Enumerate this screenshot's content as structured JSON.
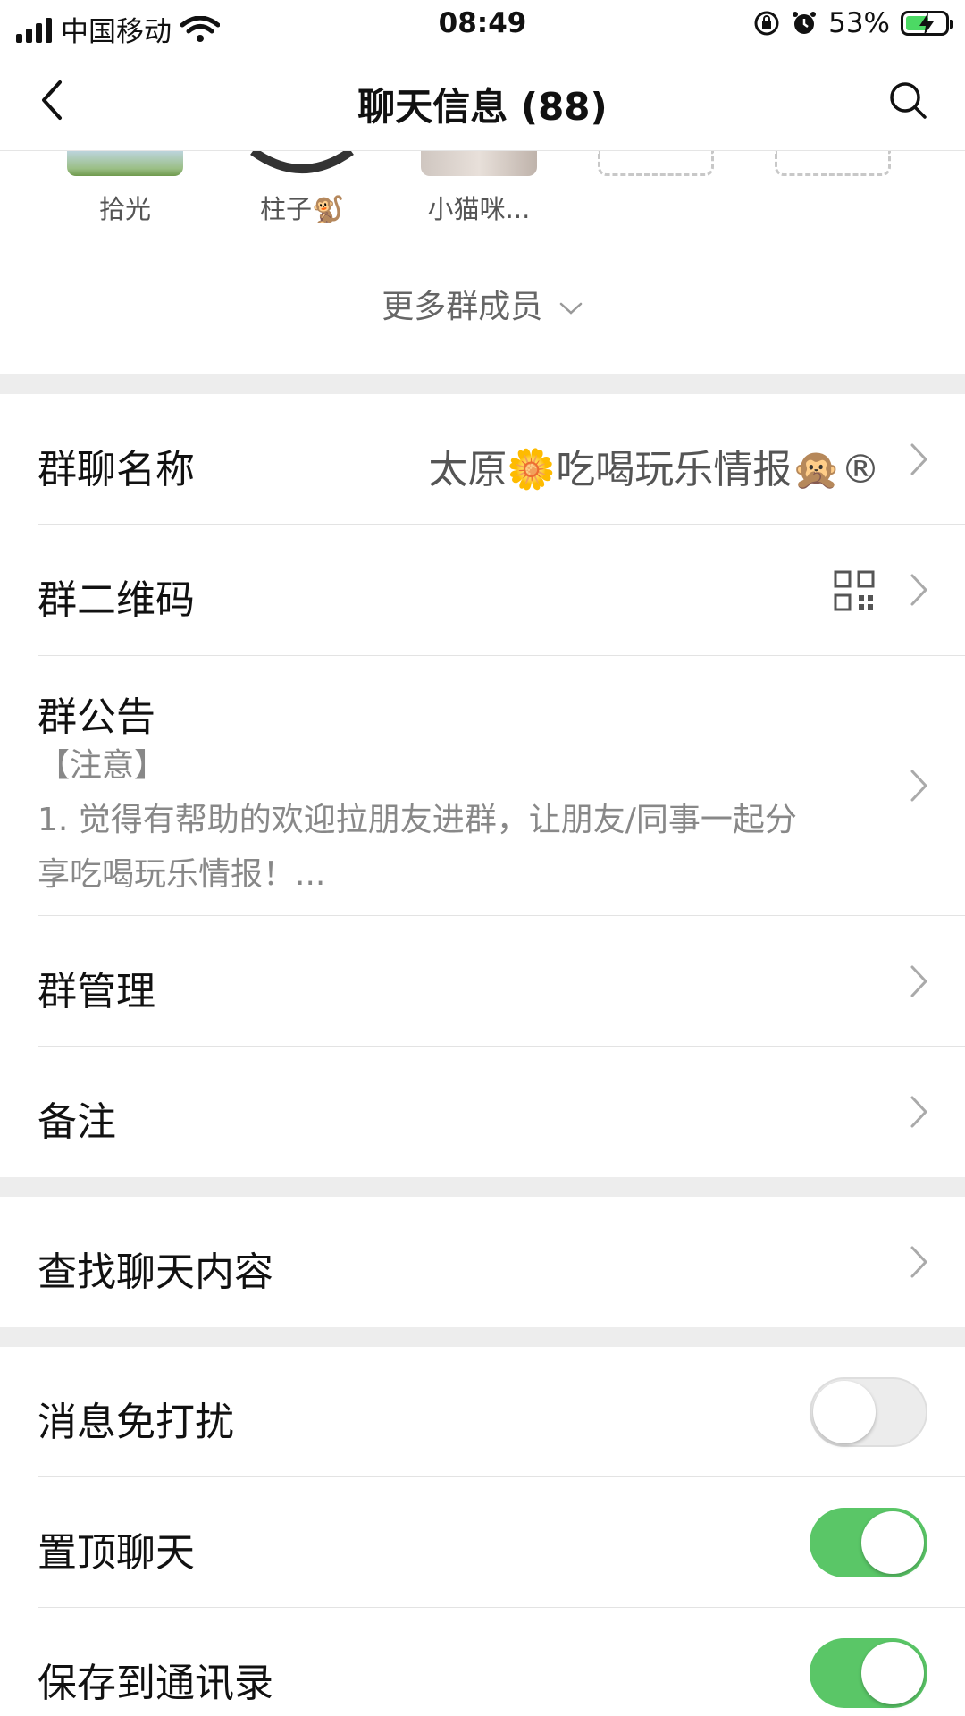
{
  "status_bar": {
    "carrier": "中国移动",
    "time": "08:49",
    "battery_percent": "53%",
    "battery_level": 0.53
  },
  "nav": {
    "title": "聊天信息 (88)"
  },
  "members": [
    {
      "name": "拾光"
    },
    {
      "name": "柱子🐒"
    },
    {
      "name": "小猫咪..."
    },
    {
      "name": ""
    },
    {
      "name": ""
    }
  ],
  "more_members_label": "更多群成员",
  "settings": {
    "group_name_label": "群聊名称",
    "group_name_value": "太原🌼吃喝玩乐情报🙊®",
    "qr_label": "群二维码",
    "notice_label": "群公告",
    "notice_text": "【注意】\n1. 觉得有帮助的欢迎拉朋友进群，让朋友/同事一起分享吃喝玩乐情报！...",
    "notice_line1": "【注意】",
    "notice_line2": "1. 觉得有帮助的欢迎拉朋友进群，让朋友/同事一起分",
    "notice_line3": "享吃喝玩乐情报！...",
    "manage_label": "群管理",
    "remark_label": "备注",
    "search_label": "查找聊天内容",
    "mute_label": "消息免打扰",
    "mute_on": false,
    "pin_label": "置顶聊天",
    "pin_on": true,
    "save_label": "保存到通讯录",
    "save_on": true
  },
  "colors": {
    "toggle_on": "#5ac667",
    "section_gap": "#ededed"
  }
}
